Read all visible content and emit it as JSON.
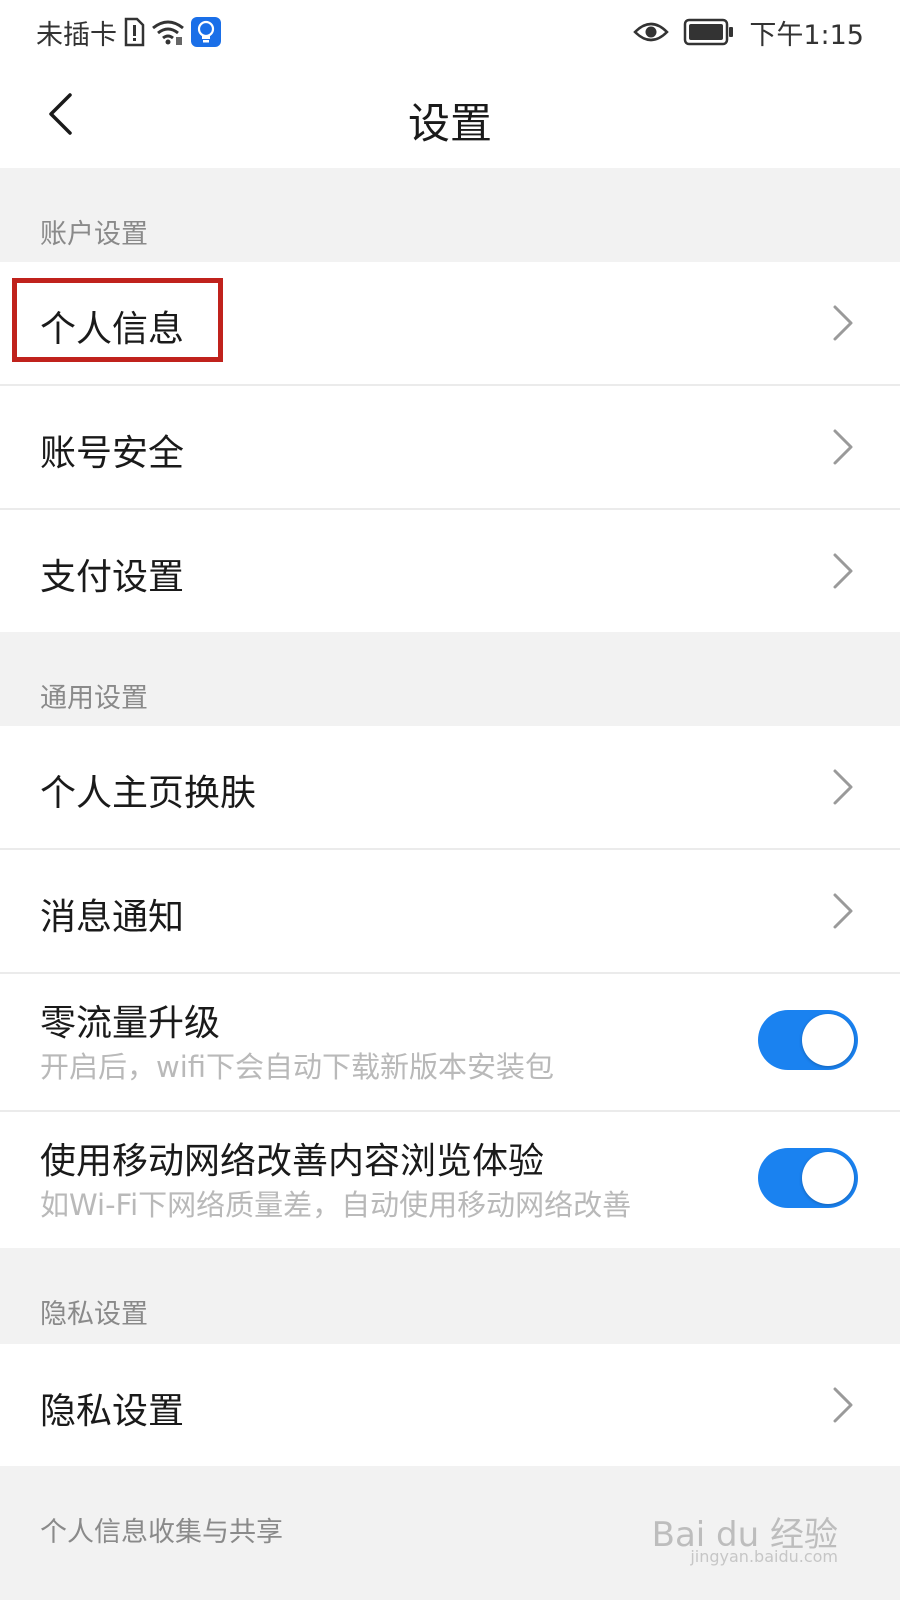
{
  "status_bar": {
    "carrier": "未插卡",
    "time": "下午1:15"
  },
  "nav": {
    "title": "设置"
  },
  "sections": [
    {
      "header": "账户设置",
      "items": [
        {
          "label": "个人信息"
        },
        {
          "label": "账号安全"
        },
        {
          "label": "支付设置"
        }
      ]
    },
    {
      "header": "通用设置",
      "items": [
        {
          "label": "个人主页换肤"
        },
        {
          "label": "消息通知"
        },
        {
          "label": "零流量升级",
          "sublabel": "开启后，wifi下会自动下载新版本安装包",
          "toggle": true
        },
        {
          "label": "使用移动网络改善内容浏览体验",
          "sublabel": "如Wi-Fi下网络质量差，自动使用移动网络改善",
          "toggle": true
        }
      ]
    },
    {
      "header": "隐私设置",
      "items": [
        {
          "label": "隐私设置"
        }
      ]
    },
    {
      "header": "个人信息收集与共享",
      "items": []
    }
  ],
  "watermark": {
    "brand": "Bai du 经验",
    "url": "jingyan.baidu.com"
  },
  "colors": {
    "accent": "#1a82f0",
    "highlight": "#c0221c",
    "page_bg": "#f2f2f2"
  }
}
